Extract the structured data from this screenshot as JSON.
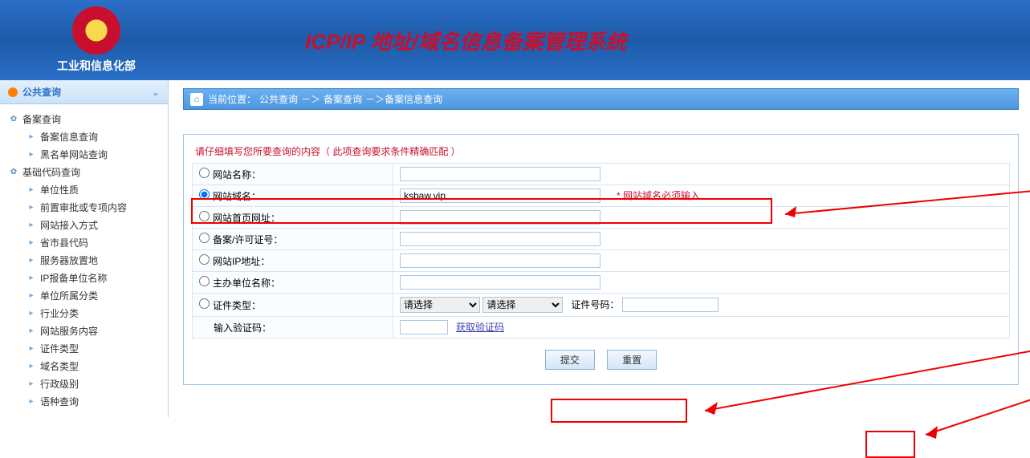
{
  "header": {
    "org": "工业和信息化部",
    "title": "ICP/IP 地址/域名信息备案管理系统"
  },
  "sidebar": {
    "header": "公共查询",
    "groups": [
      {
        "label": "备案查询",
        "items": [
          "备案信息查询",
          "黑名单网站查询"
        ]
      },
      {
        "label": "基础代码查询",
        "items": [
          "单位性质",
          "前置审批或专项内容",
          "网站接入方式",
          "省市县代码",
          "服务器放置地",
          "IP报备单位名称",
          "单位所属分类",
          "行业分类",
          "网站服务内容",
          "证件类型",
          "域名类型",
          "行政级别",
          "语种查询"
        ]
      }
    ]
  },
  "breadcrumb": {
    "prefix": "当前位置：",
    "a": "公共查询",
    "sep": "－＞",
    "b": "备案查询",
    "c": "备案信息查询"
  },
  "form": {
    "tip": "请仔细填写您所要查询的内容（ 此项查询要求条件精确匹配 ）",
    "rows": {
      "site_name": "网站名称：",
      "domain": "网站域名：",
      "homepage": "网站首页网址：",
      "license": "备案/许可证号：",
      "ip": "网站IP地址：",
      "sponsor": "主办单位名称：",
      "cert_type": "证件类型：",
      "cert_no": "证件号码：",
      "captcha": "输入验证码："
    },
    "domain_value": "ksbaw.vip",
    "domain_note": "* 网站域名必须输入",
    "select_placeholder": "请选择",
    "captcha_link": "获取验证码",
    "submit": "提交",
    "reset": "重置"
  }
}
